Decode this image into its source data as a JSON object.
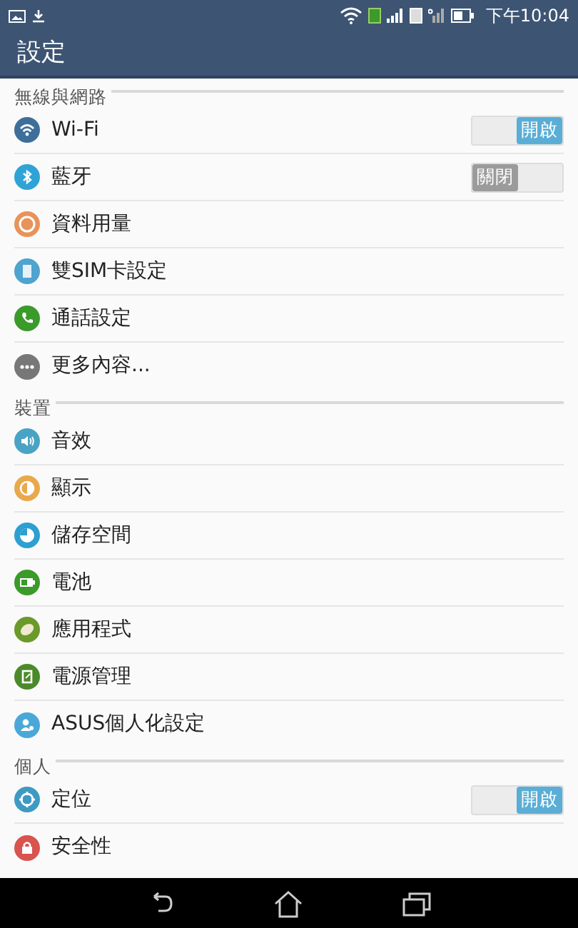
{
  "status_bar": {
    "time": "下午10:04"
  },
  "app_bar": {
    "title": "設定"
  },
  "sections": [
    {
      "title": "無線與網路",
      "items": [
        {
          "label": "Wi-Fi",
          "kind": "toggle",
          "on": true,
          "state_label": "開啟"
        },
        {
          "label": "藍牙",
          "kind": "toggle",
          "on": false,
          "state_label": "關閉"
        },
        {
          "label": "資料用量",
          "kind": "link"
        },
        {
          "label": "雙SIM卡設定",
          "kind": "link"
        },
        {
          "label": "通話設定",
          "kind": "link"
        },
        {
          "label": "更多內容...",
          "kind": "link"
        }
      ]
    },
    {
      "title": "裝置",
      "items": [
        {
          "label": "音效",
          "kind": "link"
        },
        {
          "label": "顯示",
          "kind": "link"
        },
        {
          "label": "儲存空間",
          "kind": "link"
        },
        {
          "label": "電池",
          "kind": "link"
        },
        {
          "label": "應用程式",
          "kind": "link"
        },
        {
          "label": "電源管理",
          "kind": "link"
        },
        {
          "label": "ASUS個人化設定",
          "kind": "link"
        }
      ]
    },
    {
      "title": "個人",
      "items": [
        {
          "label": "定位",
          "kind": "toggle",
          "on": true,
          "state_label": "開啟"
        },
        {
          "label": "安全性",
          "kind": "link"
        }
      ]
    }
  ]
}
